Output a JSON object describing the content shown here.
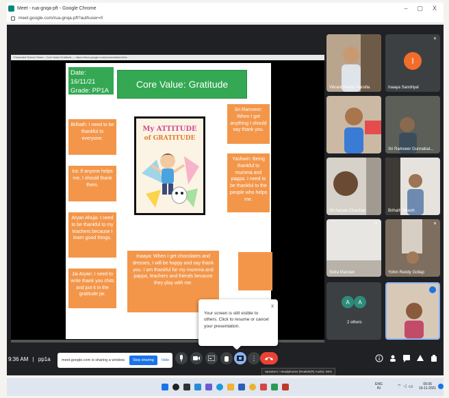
{
  "browser": {
    "title": "Meet - rua-gnqa-pft - Google Chrome",
    "url": "meet.google.com/rua-gnqa-pft?authuser=0",
    "window_controls": [
      "–",
      "▢",
      "X"
    ]
  },
  "presentation": {
    "tab_text": "Presented Screen Share - Core Value Gratitude — https://docs.google.com/presentation/d/ed..."
  },
  "slide": {
    "date_line": "Date: 16/11/21",
    "grade_line": "Grade: PP1A",
    "core_value": "Core Value: Gratitude",
    "notes": {
      "brihath": "Brihath: I need to be thankful to everyone.",
      "ira": "Ira: If anyone helps me, I should thank them.",
      "aryan_ahuja": "Aryan Ahuja: I need to be thankful to my teachers because I learn good things.",
      "jai": "Jai Aryan: I need to write thank you chits and put it in the gratitude jar.",
      "sri": "Sri Ramveer: When I get anything I should say thank you.",
      "yashwin": "Yashwin: Being thankful to mumma and pappa. I need to be thankful to the people who helps me.",
      "inaaya": "Inaaya: When I get chocolates and dresses, I will be happy and say thank you. I am thankful for my mumma and pappa, teachers and friends because they play with me."
    },
    "book": {
      "title_line1": "My ATTITUDE",
      "title_line2": "of GRATITUDE"
    },
    "book_link": "https://www.youtube.com/watch?v=ab1k2s3"
  },
  "participants": [
    {
      "name": "Vikrant Reddy Narsilla"
    },
    {
      "name": "Inaaya Sandriyal",
      "initial": "I"
    },
    {
      "name": ""
    },
    {
      "name": "Sri Ramveer Gunnabat..."
    },
    {
      "name": "Sri Aaryan Chauhan"
    },
    {
      "name": "Brihath Sikesh"
    },
    {
      "name": "Sidra Mandari"
    },
    {
      "name": "Yohin Reddy Gollap"
    },
    {
      "name": "2 others",
      "initials": [
        "A",
        "A"
      ]
    },
    {
      "name": ""
    }
  ],
  "popup": {
    "text": "Your screen is still visible to others. Click to resume or cancel your presentation.",
    "close": "x"
  },
  "controls": {
    "time": "9:36 AM",
    "meeting_code": "pp1a",
    "share_msg": "meet.google.com is sharing a window.",
    "stop_label": "Stop sharing",
    "hide_label": "Hide",
    "tooltip": "Speakers / Headphones (Realtek(R) Audio): 66%"
  },
  "taskbar": {
    "lang": "ENG",
    "lang2": "IN",
    "clock": "09:36",
    "date": "16-11-2021"
  },
  "colors": {
    "accent_green": "#34a853",
    "note_orange": "#f3964a",
    "end_call_red": "#ea4335",
    "stop_blue": "#1a73e8"
  }
}
